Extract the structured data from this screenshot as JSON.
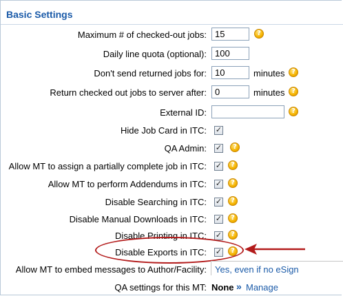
{
  "section": {
    "title": "Basic Settings"
  },
  "rows": {
    "max_jobs": {
      "label": "Maximum # of checked-out jobs:",
      "value": "15"
    },
    "daily_quota": {
      "label": "Daily line quota (optional):",
      "value": "100"
    },
    "dont_send": {
      "label": "Don't send returned jobs for:",
      "value": "10",
      "unit": "minutes"
    },
    "return_jobs": {
      "label": "Return checked out jobs to server after:",
      "value": "0",
      "unit": "minutes"
    },
    "external_id": {
      "label": "External ID:",
      "value": ""
    },
    "hide_job_card": {
      "label": "Hide Job Card in ITC:",
      "checked": true
    },
    "qa_admin": {
      "label": "QA Admin:",
      "checked": true
    },
    "allow_partial": {
      "label": "Allow MT to assign a partially complete job in ITC:",
      "checked": true
    },
    "allow_addendums": {
      "label": "Allow MT to perform Addendums in ITC:",
      "checked": true
    },
    "disable_search": {
      "label": "Disable Searching in ITC:",
      "checked": true
    },
    "disable_downloads": {
      "label": "Disable Manual Downloads in ITC:",
      "checked": true
    },
    "disable_printing": {
      "label": "Disable Printing in ITC:",
      "checked": true
    },
    "disable_exports": {
      "label": "Disable Exports in ITC:",
      "checked": true
    },
    "embed_messages": {
      "label": "Allow MT to embed messages to Author/Facility:",
      "value": "Yes, even if no eSign"
    },
    "qa_settings": {
      "label": "QA settings for this MT:",
      "value": "None",
      "link_icon": "»",
      "link": "Manage"
    }
  },
  "icons": {
    "help": "?",
    "check": "✓"
  },
  "colors": {
    "accent": "#1a5aa8",
    "highlight": "#b31b1b",
    "help": "#f5b400"
  }
}
